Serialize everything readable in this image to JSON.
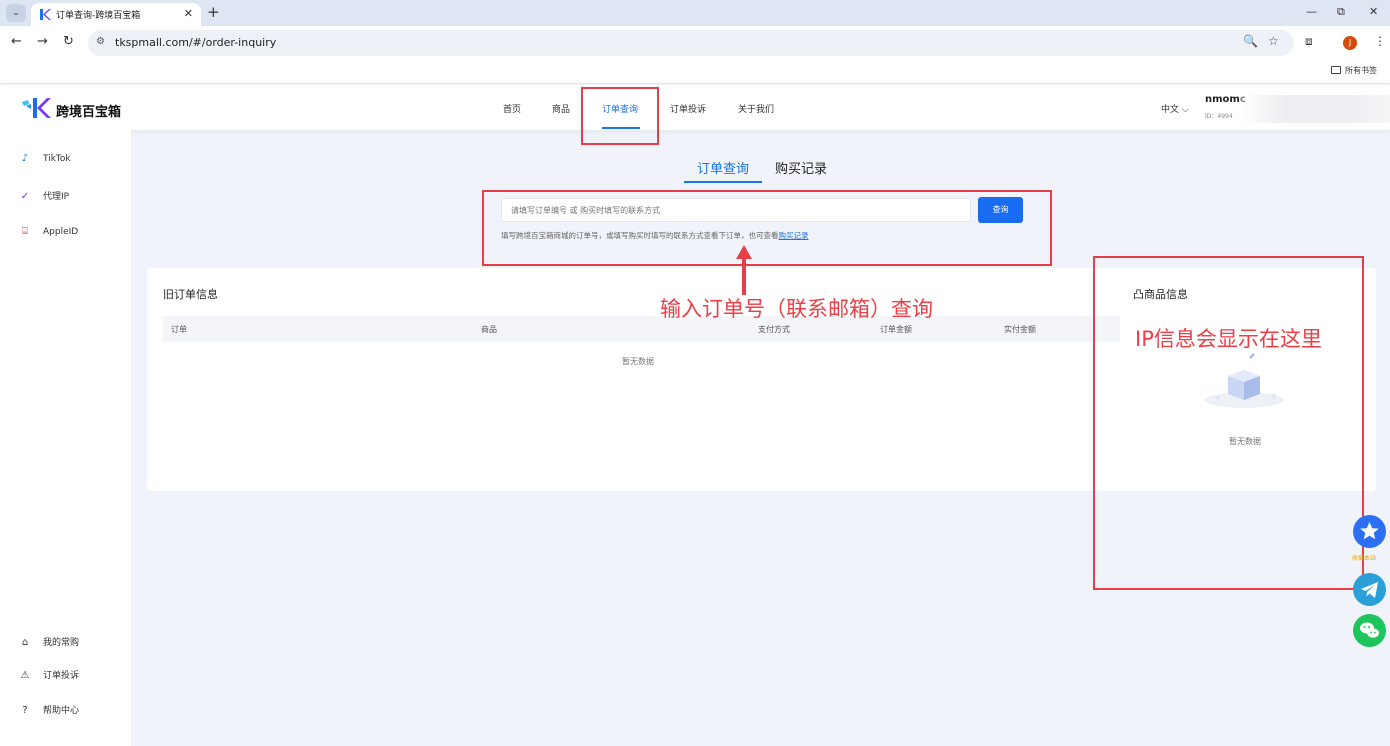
{
  "browser": {
    "tab_title": "订单查询-跨境百宝箱",
    "url": "tkspmall.com/#/order-inquiry",
    "bookmarks_folder": "所有书签",
    "profile_initial": "J"
  },
  "header": {
    "logo_text": "跨境百宝箱",
    "nav": [
      "首页",
      "商品",
      "订单查询",
      "订单投诉",
      "关于我们"
    ],
    "active_nav_index": 2,
    "language": "中文",
    "username": "nmomc",
    "user_id": "ID：4994"
  },
  "sidebar": {
    "top_items": [
      {
        "label": "TikTok",
        "icon": "tiktok-icon"
      },
      {
        "label": "代理IP",
        "icon": "proxy-ip-icon"
      },
      {
        "label": "AppleID",
        "icon": "apple-id-icon"
      }
    ],
    "bottom_items": [
      {
        "label": "我的常购",
        "icon": "bag-icon"
      },
      {
        "label": "订单投诉",
        "icon": "warning-icon"
      },
      {
        "label": "帮助中心",
        "icon": "help-icon"
      }
    ]
  },
  "main": {
    "tabs": [
      "订单查询",
      "购买记录"
    ],
    "active_tab_index": 0,
    "search": {
      "placeholder": "请填写订单编号 或 购买时填写的联系方式",
      "button": "查询",
      "hint": "填写跨境百宝箱商城的订单号，或填写购买时填写的联系方式查看下订单，也可查看",
      "hint_link": "购买记录"
    },
    "order_info": {
      "title": "旧订单信息",
      "columns": [
        "订单",
        "商品",
        "支付方式",
        "订单金额",
        "实付金额"
      ],
      "rows": [],
      "empty": "暂无数据"
    },
    "product_info": {
      "title": "凸商品信息",
      "empty": "暂无数据"
    }
  },
  "annotations": {
    "search_note": "输入订单号（联系邮箱）查询",
    "ip_note": "IP信息会显示在这里"
  },
  "floating": {
    "bookmark_label": "收藏本站"
  },
  "colors": {
    "primary": "#1a73e8",
    "annotation": "#e5404a",
    "page_bg": "#f0f3fa"
  }
}
